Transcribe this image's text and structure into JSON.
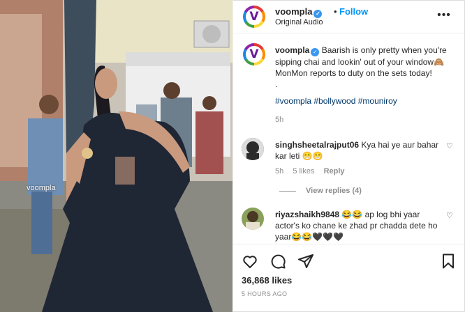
{
  "post": {
    "username": "voompla",
    "verified_mark": "✓",
    "separator": "•",
    "follow_label": "Follow",
    "audio_label": "Original Audio",
    "more_icon": "more-options-icon",
    "avatar_letter": "V",
    "media_watermark": "voompla"
  },
  "caption": {
    "username": "voompla",
    "text": "Baarish is only pretty when you're sipping chai and lookin' out of your window🙈 MonMon reports to duty on the sets today!",
    "dot": ".",
    "hashtags": "#voompla #bollywood #mouniroy",
    "age": "5h"
  },
  "comments": [
    {
      "username": "singhsheetalrajput06",
      "text": "Kya hai ye aur bahar kar leti 😁😁",
      "age": "5h",
      "likes": "5 likes",
      "reply_label": "Reply",
      "view_replies": "View replies (4)"
    },
    {
      "username": "riyazshaikh9848",
      "text": "😂😂 ap log bhi yaar actor's ko chane ke zhad pr chadda dete ho yaar😂😂🖤🖤🖤"
    }
  ],
  "actions": {
    "like_icon": "heart-icon",
    "comment_icon": "comment-icon",
    "share_icon": "share-icon",
    "save_icon": "bookmark-icon",
    "likes_text": "36,868 likes",
    "timestamp": "5 HOURS AGO"
  },
  "colors": {
    "link_blue": "#0095f6",
    "hashtag_blue": "#00376b",
    "muted": "#8e8e8e",
    "verified": "#3897f0"
  }
}
